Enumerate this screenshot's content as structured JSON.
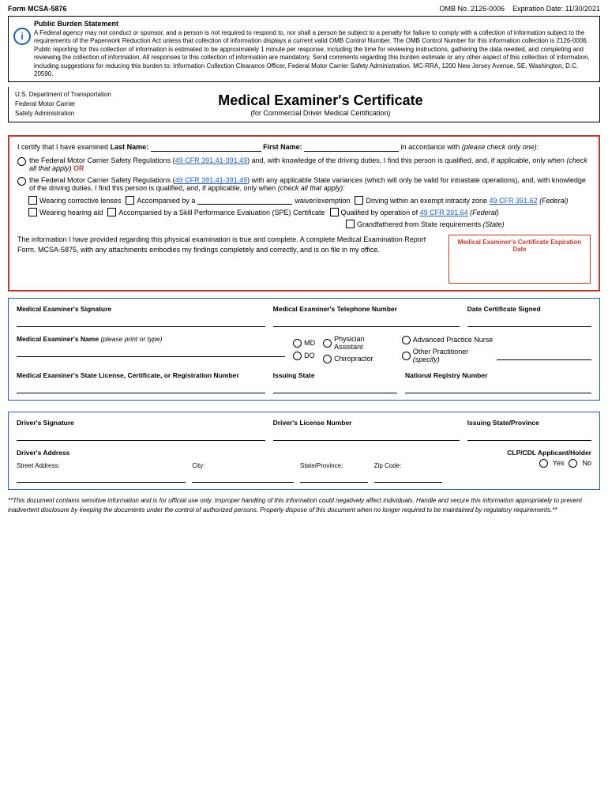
{
  "header": {
    "form_number": "Form MCSA-5876",
    "omb_number": "OMB No. 2126-0006",
    "expiration": "Expiration Date: 11/30/2021"
  },
  "burden": {
    "title": "Public Burden Statement",
    "text": "A Federal agency may not conduct or sponsor, and a person is not required to respond to, nor shall a person be subject to a penalty for failure to comply with a collection of information subject to the requirements of the Paperwork Reduction Act unless that collection of information displays a current valid OMB Control Number. The OMB Control Number for this information collection is 2126-0006. Public reporting for this collection of information is estimated to be approximately 1 minute per response, including the time for reviewing instructions, gathering the data needed, and completing and reviewing the collection of information. All responses to this collection of information are mandatory. Send comments regarding this burden estimate or any other aspect of this collection of information, including suggestions for reducing this burden to: Information Collection Clearance Officer, Federal Motor Carrier Safety Administration, MC-RRA, 1200 New Jersey Avenue, SE, Washington, D.C. 20590."
  },
  "agency": {
    "line1": "U.S. Department of Transportation",
    "line2": "Federal Motor Carrier",
    "line3": "Safety Administration",
    "title": "Medical Examiner's Certificate",
    "subtitle": "(for Commercial Driver Medical Certification)"
  },
  "certification": {
    "intro": "I certify that I have examined",
    "last_name_label": "Last Name:",
    "first_name_label": "First Name:",
    "accordance": "in accordance with",
    "please_check": "(please check only one):",
    "option1_pre": "the Federal Motor Carrier Safety Regulations (",
    "option1_link": "49 CFR 391.41-391.49",
    "option1_mid": ") and, with knowledge of the driving duties, I find this person is qualified, and, if applicable, only when",
    "option1_check_all": "(check all that apply)",
    "option1_bold": " OR",
    "option2_pre": "the Federal Motor Carrier Safety Regulations (",
    "option2_link": "49 CFR 391.41-391.49",
    "option2_mid": ") with any applicable State variances (which will only be valid for intrastate operations), and, with knowledge of the driving duties, I find this person is qualified, and, if applicable, only when",
    "option2_check_all": "(check all that apply):",
    "checkboxes": [
      {
        "label": "Wearing corrective lenses"
      },
      {
        "label": "Accompanied by a"
      },
      {
        "label": "waiver/exemption"
      },
      {
        "label": "Driving within an exempt intracity zone"
      },
      {
        "label": "(49 CFR 391.62)"
      },
      {
        "label": "(Federal)"
      },
      {
        "label": "Wearing hearing aid"
      },
      {
        "label": "Accompanied by a Skill Performance Evaluation (SPE) Certificate"
      },
      {
        "label": "Qualified by operation of"
      },
      {
        "label": "49 CFR 391.64"
      },
      {
        "label": "(Federal)"
      },
      {
        "label": "Grandfathered from State requirements"
      },
      {
        "label": "(State)"
      }
    ],
    "statement": "The information I have provided regarding this physical examination is true and complete. A complete Medical Examination Report Form, MCSA-5875, with any attachments embodies my findings completely and correctly, and is on file in my office.",
    "expiry_label": "Medical Examiner's Certificate Expiration Date"
  },
  "examiner": {
    "sig_label": "Medical Examiner's Signature",
    "phone_label": "Medical Examiner's Telephone Number",
    "date_label": "Date Certificate Signed",
    "name_label": "Medical Examiner's Name",
    "name_note": "(please print or type)",
    "md_label": "MD",
    "do_label": "DO",
    "pa_label": "Physician Assistant",
    "chiro_label": "Chiropractor",
    "apn_label": "Advanced Practice Nurse",
    "other_label": "Other Practitioner",
    "other_specify": "(specify)",
    "lic_label": "Medical Examiner's State License, Certificate, or Registration Number",
    "issuing_label": "Issuing State",
    "registry_label": "National Registry Number"
  },
  "driver": {
    "sig_label": "Driver's Signature",
    "license_label": "Driver's License Number",
    "issuing_label": "Issuing State/Province",
    "addr_label": "Driver's Address",
    "clp_label": "CLP/CDL Applicant/Holder",
    "street_label": "Street Address:",
    "city_label": "City:",
    "state_label": "State/Province:",
    "zip_label": "Zip Code:",
    "yes_label": "Yes",
    "no_label": "No"
  },
  "footer": {
    "text": "**This document contains sensitive information and is for official use only. Improper handling of this information could negatively affect individuals. Handle and secure this information appropriately to prevent inadvertent disclosure by keeping the documents under the control of authorized persons. Properly dispose of this document when no longer required to be maintained by regulatory requirements.**"
  }
}
